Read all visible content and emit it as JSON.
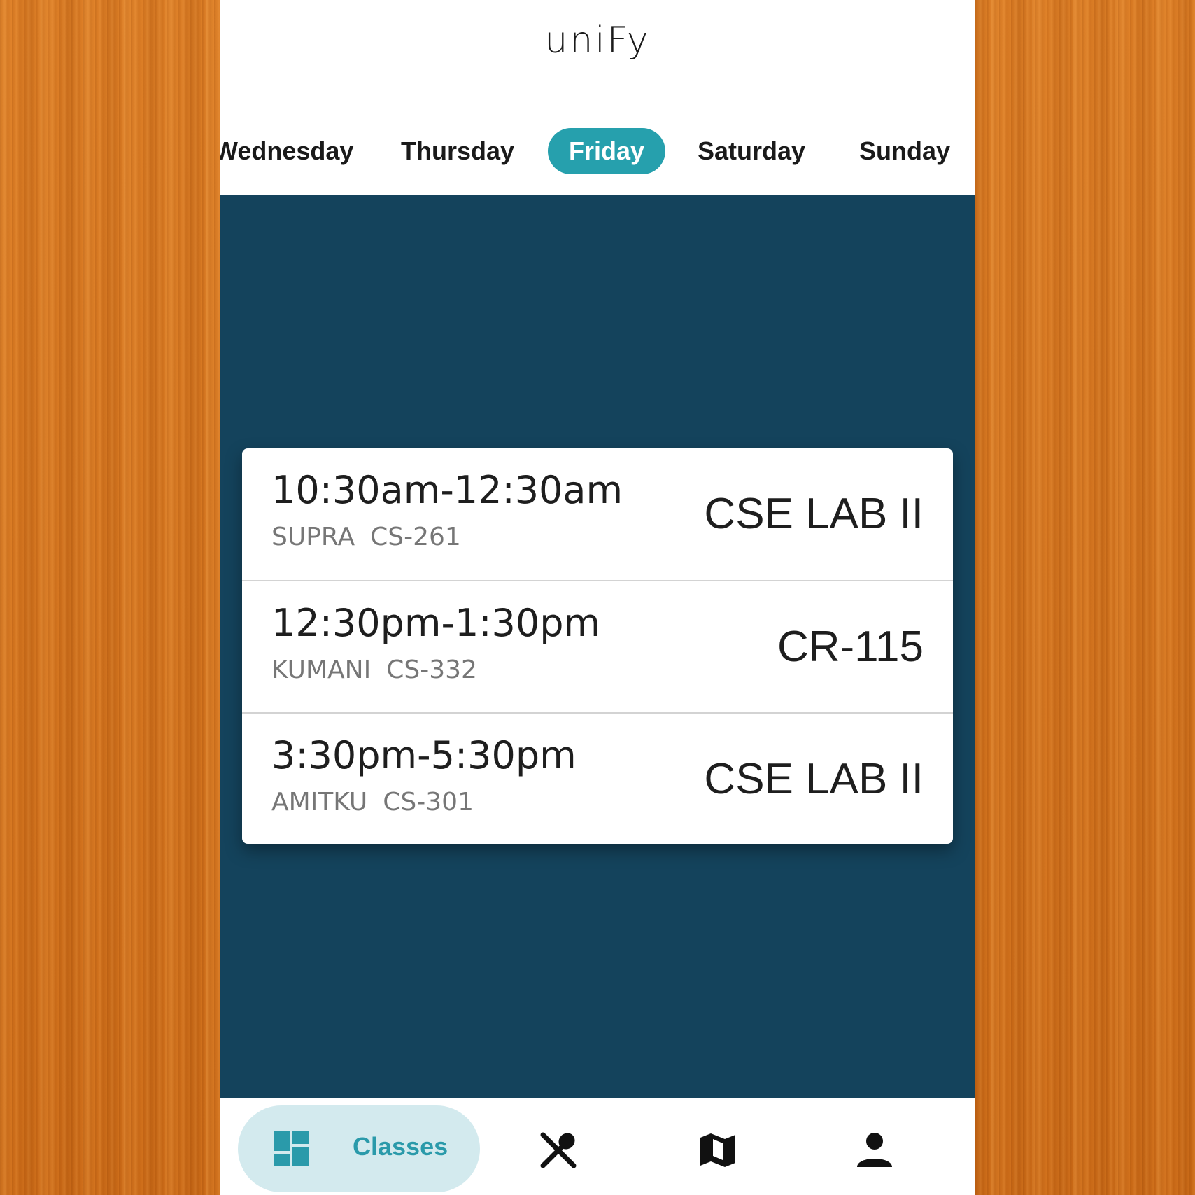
{
  "app": {
    "title": "uniFy"
  },
  "days": {
    "items": [
      "Wednesday",
      "Thursday",
      "Friday",
      "Saturday",
      "Sunday"
    ],
    "selected": "Friday"
  },
  "schedule": [
    {
      "time": "10:30am-12:30am",
      "instructor": "SUPRA",
      "course": "CS-261",
      "room": "CSE LAB II"
    },
    {
      "time": "12:30pm-1:30pm",
      "instructor": "KUMANI",
      "course": "CS-332",
      "room": "CR-115"
    },
    {
      "time": "3:30pm-5:30pm",
      "instructor": "AMITKU",
      "course": "CS-301",
      "room": "CSE LAB II"
    }
  ],
  "nav": {
    "active_label": "Classes",
    "icons": [
      "dashboard-icon",
      "restaurant-icon",
      "map-icon",
      "person-icon"
    ]
  },
  "colors": {
    "accent": "#26a0ad",
    "content_background": "#14435c",
    "nav_pill": "#d3eaee",
    "side_background": "#d8751c"
  }
}
